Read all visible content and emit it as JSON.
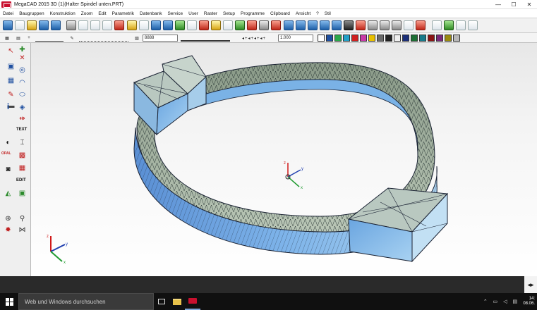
{
  "window": {
    "title": "MegaCAD 2015 3D (1)(Halter Spindel unten.PRT)",
    "minimize_glyph": "—",
    "maximize_glyph": "☐",
    "close_glyph": "✕"
  },
  "menu": {
    "items": [
      "Datei",
      "Baugruppen",
      "Konstruktion",
      "Zoom",
      "Edit",
      "Parametrik",
      "Datenbank",
      "Service",
      "User",
      "Raster",
      "Setup",
      "Programme",
      "Clipboard",
      "Ansicht",
      "?",
      "Stil"
    ]
  },
  "left_toolbar": {
    "text_label": "TEXT",
    "opal_label": "OPAL",
    "edit_label": "EDIT",
    "info_glyph": "i"
  },
  "toolbar2": {
    "zoom_value": "1.000",
    "pattern_label": "8888"
  },
  "colors": {
    "swatches": [
      "#ffffff",
      "#1f4fa0",
      "#2aa84a",
      "#22a0c8",
      "#d02020",
      "#c83aa8",
      "#e8c000",
      "#6a6a6a",
      "#222222",
      "#f0f0f0"
    ]
  },
  "taskbar": {
    "search_placeholder": "Web und Windows durchsuchen",
    "time": "14:",
    "date": "08.06."
  },
  "nav": {
    "arrow_glyph": "◂▸"
  }
}
